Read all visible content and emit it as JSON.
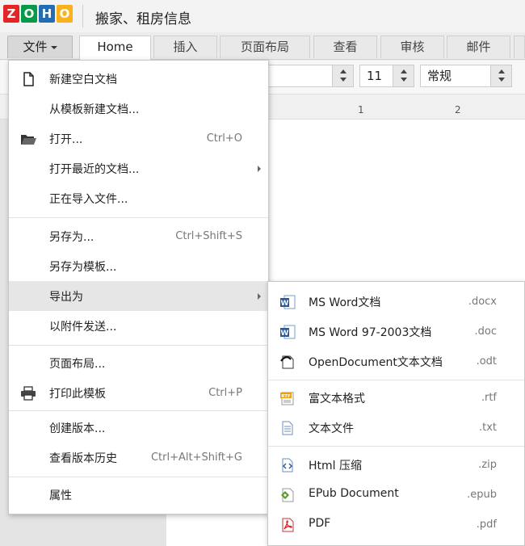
{
  "app": {
    "doc_title": "搬家、租房信息",
    "logo_letters": [
      "Z",
      "O",
      "H",
      "O"
    ],
    "logo_colors": [
      "#e42527",
      "#089949",
      "#226db4",
      "#f9b21d"
    ]
  },
  "tabs": {
    "file": "文件",
    "items": [
      "Home",
      "插入",
      "页面布局",
      "查看",
      "审核",
      "邮件"
    ]
  },
  "toolbar": {
    "font_size": "11",
    "style": "常规"
  },
  "ruler": {
    "marks": [
      "1",
      "2"
    ]
  },
  "file_menu": {
    "items": [
      {
        "label": "新建空白文档",
        "shortcut": "",
        "icon": "new-document-icon"
      },
      {
        "label": "从模板新建文档...",
        "shortcut": ""
      },
      {
        "label": "打开...",
        "shortcut": "Ctrl+O",
        "icon": "folder-open-icon"
      },
      {
        "label": "打开最近的文档...",
        "shortcut": "",
        "submenu": true
      },
      {
        "label": "正在导入文件...",
        "shortcut": ""
      },
      {
        "label": "另存为...",
        "shortcut": "Ctrl+Shift+S"
      },
      {
        "label": "另存为模板...",
        "shortcut": ""
      },
      {
        "label": "导出为",
        "shortcut": "",
        "submenu": true,
        "highlighted": true
      },
      {
        "label": "以附件发送...",
        "shortcut": ""
      },
      {
        "label": "页面布局...",
        "shortcut": ""
      },
      {
        "label": "打印此模板",
        "shortcut": "Ctrl+P",
        "icon": "printer-icon"
      },
      {
        "label": "创建版本...",
        "shortcut": ""
      },
      {
        "label": "查看版本历史",
        "shortcut": "Ctrl+Alt+Shift+G"
      },
      {
        "label": "属性",
        "shortcut": ""
      }
    ]
  },
  "export_menu": {
    "items": [
      {
        "label": "MS Word文档",
        "ext": ".docx",
        "icon": "word-doc-icon"
      },
      {
        "label": "MS Word 97-2003文档",
        "ext": ".doc",
        "icon": "word-doc-icon"
      },
      {
        "label": "OpenDocument文本文档",
        "ext": ".odt",
        "icon": "odt-doc-icon"
      },
      {
        "label": "富文本格式",
        "ext": ".rtf",
        "icon": "rtf-doc-icon"
      },
      {
        "label": "文本文件",
        "ext": ".txt",
        "icon": "text-file-icon"
      },
      {
        "label": "Html 压缩",
        "ext": ".zip",
        "icon": "html-file-icon"
      },
      {
        "label": "EPub Document",
        "ext": ".epub",
        "icon": "epub-file-icon"
      },
      {
        "label": "PDF",
        "ext": ".pdf",
        "icon": "pdf-file-icon"
      }
    ]
  }
}
